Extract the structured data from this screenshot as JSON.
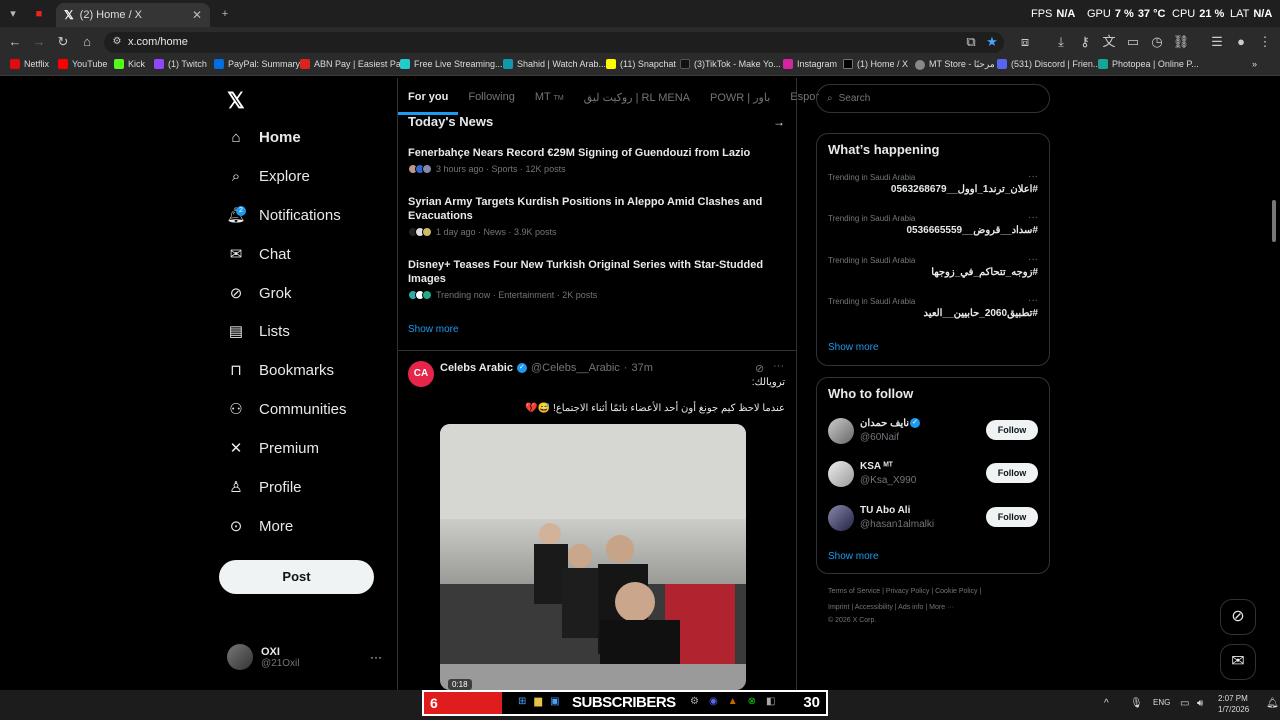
{
  "browser": {
    "tab_title": "(2) Home / X",
    "url": "x.com/home",
    "overlay": {
      "fps_label": "FPS",
      "fps_value": "N/A",
      "gpu_label": "GPU",
      "gpu_value": "7 %",
      "gpu_temp": "37 °C",
      "cpu_label": "CPU",
      "cpu_value": "21 %",
      "lat_label": "LAT",
      "lat_value": "N/A"
    },
    "bookmarks": [
      "Netflix",
      "YouTube",
      "Kick",
      "(1) Twitch",
      "PayPal: Summary",
      "ABN Pay | Easiest Pa...",
      "Free Live Streaming...",
      "Shahid | Watch Arab...",
      "(11) Snapchat",
      "(3)TikTok - Make Yo...",
      "Instagram",
      "(1) Home / X",
      "MT Store - مرحبًا",
      "(531) Discord | Frien...",
      "Photopea | Online P..."
    ]
  },
  "sidebar": {
    "items": [
      {
        "label": "Home",
        "icon": "home-icon"
      },
      {
        "label": "Explore",
        "icon": "search-icon"
      },
      {
        "label": "Notifications",
        "icon": "bell-icon"
      },
      {
        "label": "Chat",
        "icon": "mail-icon"
      },
      {
        "label": "Grok",
        "icon": "grok-icon"
      },
      {
        "label": "Lists",
        "icon": "list-icon"
      },
      {
        "label": "Bookmarks",
        "icon": "bookmark-icon"
      },
      {
        "label": "Communities",
        "icon": "people-icon"
      },
      {
        "label": "Premium",
        "icon": "x-icon"
      },
      {
        "label": "Profile",
        "icon": "person-icon"
      },
      {
        "label": "More",
        "icon": "more-circle-icon"
      }
    ],
    "notif_badge": "2",
    "post_label": "Post",
    "user": {
      "name": "OXI",
      "handle": "@21Oxil"
    }
  },
  "main": {
    "tabs": [
      "For you",
      "Following",
      "MT",
      "روكيت ليق | RL MENA",
      "POWR | باور",
      "Espor"
    ],
    "tab_mt_suffix": "TM",
    "news_heading": "Today's News",
    "news": [
      {
        "title": "Fenerbahçe Nears Record €29M Signing of Guendouzi from Lazio",
        "meta": "3 hours ago · Sports · 12K posts"
      },
      {
        "title": "Syrian Army Targets Kurdish Positions in Aleppo Amid Clashes and Evacuations",
        "meta": "1 day ago · News · 3.9K posts"
      },
      {
        "title": "Disney+ Teases Four New Turkish Original Series with Star-Studded Images",
        "meta": "Trending now · Entertainment · 2K posts"
      }
    ],
    "show_more": "Show more",
    "tweet": {
      "author": "Celebs Arabic",
      "handle": "@Celebs__Arabic",
      "time": "37m",
      "line1": "ترويالك:",
      "line2": "عندما لاحظ كيم جونغ أون أحد الأعضاء نائمًا أثناء الاجتماع! 😅💔",
      "video_time": "0:18"
    }
  },
  "right": {
    "search_placeholder": "Search",
    "whats_happening": "What’s happening",
    "trends": [
      {
        "context": "Trending in Saudi Arabia",
        "name": "#اعلان_ترند1_اوول__0563268679"
      },
      {
        "context": "Trending in Saudi Arabia",
        "name": "#سداد__قروض__0536665559"
      },
      {
        "context": "Trending in Saudi Arabia",
        "name": "#زوجه_تتحاكم_في_زوجها"
      },
      {
        "context": "Trending in Saudi Arabia",
        "name": "#تطبيق2060_حابيين__العيد"
      }
    ],
    "show_more": "Show more",
    "who_to_follow": "Who to follow",
    "follow": [
      {
        "name": "نايف حمدان",
        "handle": "@60Naif",
        "button": "Follow"
      },
      {
        "name": "KSA ᴹᵀ",
        "handle": "@Ksa_X990",
        "button": "Follow"
      },
      {
        "name": "TU Abo Ali",
        "handle": "@hasan1almalki",
        "button": "Follow"
      }
    ],
    "show_more2": "Show more",
    "footer": {
      "line1": "Terms of Service  |  Privacy Policy  |  Cookie Policy  |",
      "line2": "Imprint  |  Accessibility  |  Ads info  |  More ···",
      "line3": "© 2026 X Corp."
    }
  },
  "taskbar": {
    "sub_count_left": "6",
    "sub_label": "SUBSCRIBERS",
    "sub_count_right": "30",
    "lang": "ENG",
    "time": "2:07 PM",
    "date": "1/7/2026"
  }
}
